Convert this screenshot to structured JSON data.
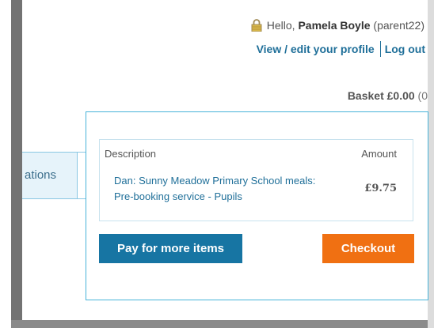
{
  "header": {
    "greeting_prefix": "Hello, ",
    "user_name": "Pamela Boyle",
    "user_id": "(parent22)",
    "profile_link": "View / edit your profile",
    "logout_link": "Log out",
    "lock_icon": "lock-icon"
  },
  "basket": {
    "label": "Basket £0.00",
    "count": "(0"
  },
  "nav": {
    "tab_label": "ations"
  },
  "basket_panel": {
    "columns": [
      "Description",
      "Amount"
    ],
    "rows": [
      {
        "description": "Dan: Sunny Meadow Primary School meals: Pre-booking service - Pupils",
        "amount": "£9.75"
      }
    ],
    "pay_button": "Pay for more items",
    "checkout_button": "Checkout"
  },
  "colors": {
    "link": "#1f6f99",
    "panel_border": "#47b3d9",
    "pay_button": "#1775a3",
    "checkout_button": "#f07012"
  }
}
